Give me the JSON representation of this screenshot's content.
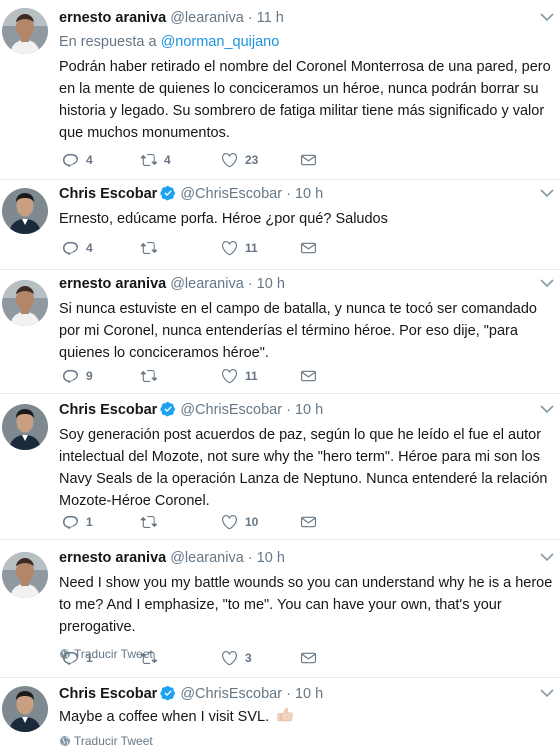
{
  "tweets": [
    {
      "author": "ernesto araniva",
      "handle": "@learaniva",
      "time": "11 h",
      "verified": false,
      "reply_prefix": "En respuesta a",
      "reply_to": "@norman_quijano",
      "text": "Podrán haber retirado el nombre del Coronel Monterrosa  de una pared, pero en la mente de quienes lo conciceramos un héroe, nunca podrán borrar su historia y legado. Su sombrero de fatiga militar tiene más significado y valor que muchos monumentos.",
      "replies": "4",
      "retweets": "4",
      "likes": "23"
    },
    {
      "author": "Chris Escobar",
      "handle": "@ChrisEscobar",
      "time": "10 h",
      "verified": true,
      "text": "Ernesto, edúcame porfa. Héroe ¿por qué? Saludos",
      "replies": "4",
      "retweets": "",
      "likes": "11"
    },
    {
      "author": "ernesto araniva",
      "handle": "@learaniva",
      "time": "10 h",
      "verified": false,
      "text": "Si nunca estuviste en el campo de batalla, y nunca te tocó ser comandado por mi Coronel, nunca entenderías el término héroe. Por eso dije, \"para quienes lo conciceramos héroe\".",
      "replies": "9",
      "retweets": "",
      "likes": "11"
    },
    {
      "author": "Chris Escobar",
      "handle": "@ChrisEscobar",
      "time": "10 h",
      "verified": true,
      "text": "Soy generación post acuerdos de paz, según lo que he leído el fue el autor intelectual del Mozote, not sure why the \"hero term\". Héroe para mi son los Navy Seals de la operación Lanza de Neptuno. Nunca entenderé la relación Mozote-Héroe Coronel.",
      "replies": "1",
      "retweets": "",
      "likes": "10"
    },
    {
      "author": "ernesto araniva",
      "handle": "@learaniva",
      "time": "10 h",
      "verified": false,
      "text": "Need I show you my battle wounds so you can understand why he is a heroe to me? And I emphasize, \"to me\". You can have your own, that's your prerogative.",
      "translate": "Traducir Tweet",
      "replies": "1",
      "retweets": "",
      "likes": "3"
    },
    {
      "author": "Chris Escobar",
      "handle": "@ChrisEscobar",
      "time": "10 h",
      "verified": true,
      "text": "Maybe a coffee when I visit SVL.",
      "emoji": "thumbs-up-light-skin",
      "translate": "Traducir Tweet"
    }
  ],
  "separator": "·",
  "colors": {
    "link": "#1b95e0",
    "muted": "#657786",
    "verified": "#1da1f2"
  }
}
